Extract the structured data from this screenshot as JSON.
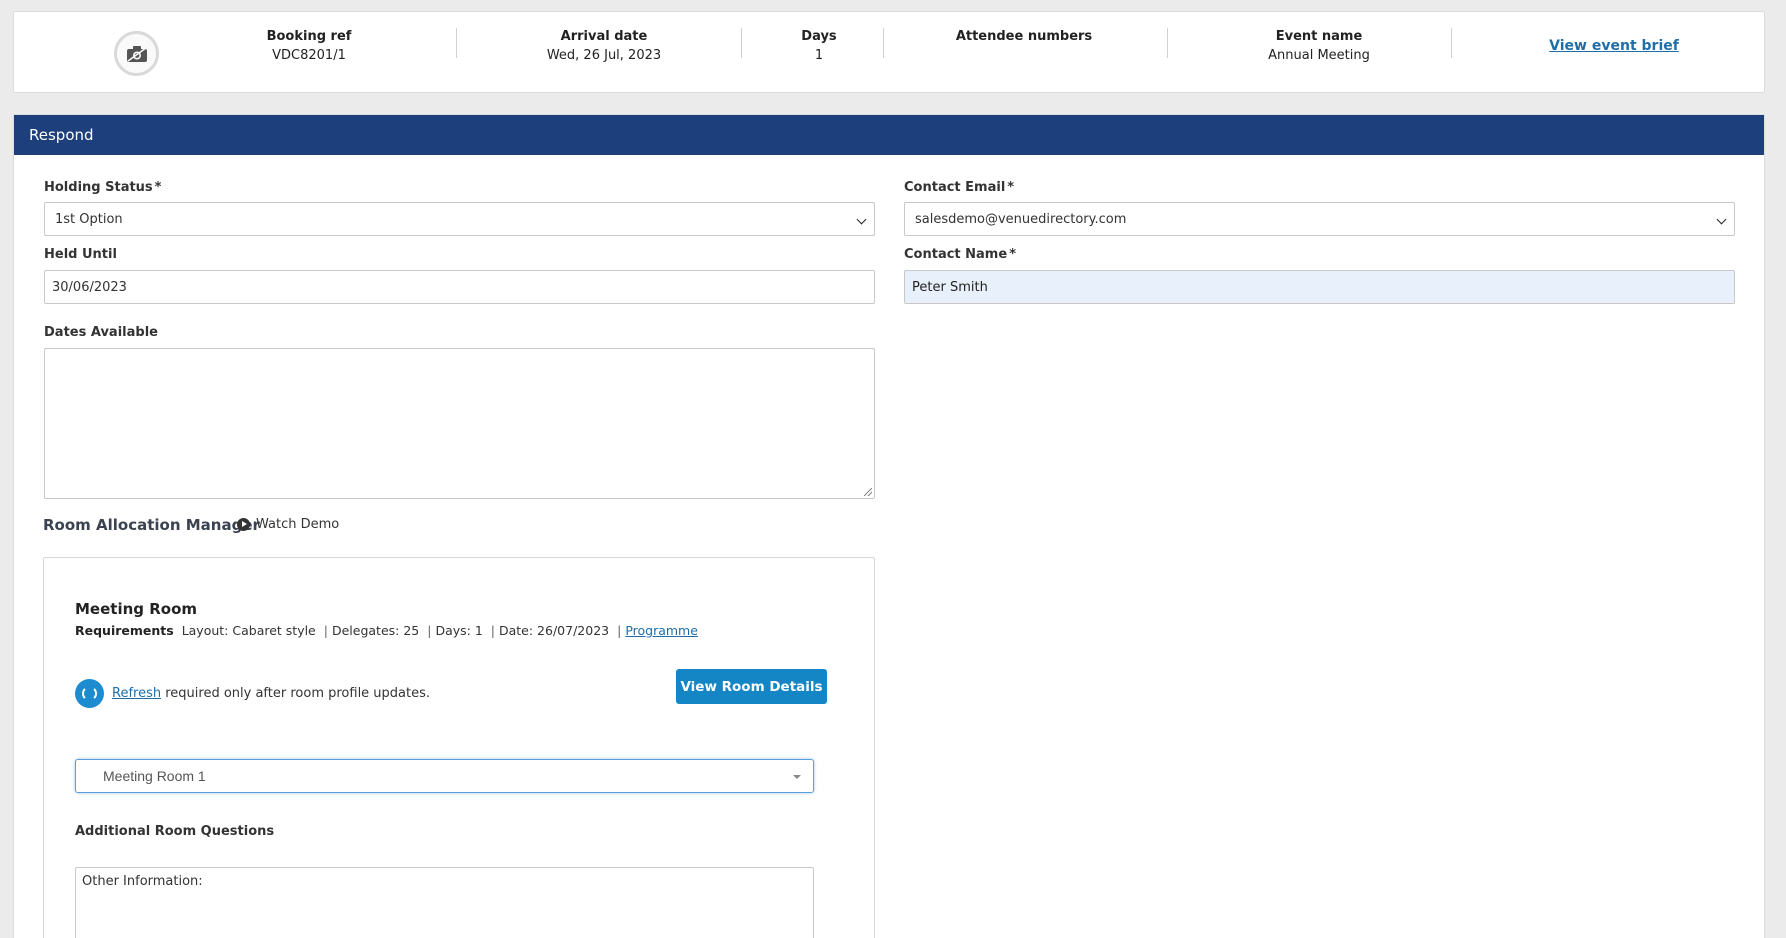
{
  "summary": {
    "booking_ref_label": "Booking ref",
    "booking_ref": "VDC8201/1",
    "arrival_label": "Arrival date",
    "arrival": "Wed, 26 Jul, 2023",
    "days_label": "Days",
    "days": "1",
    "attendees_label": "Attendee numbers",
    "attendees": "",
    "event_label": "Event name",
    "event": "Annual Meeting",
    "view_brief": "View event brief"
  },
  "panel": {
    "title": "Respond"
  },
  "form": {
    "holding_status_label": "Holding Status",
    "holding_status_value": "1st Option",
    "held_until_label": "Held Until",
    "held_until_value": "30/06/2023",
    "dates_available_label": "Dates Available",
    "dates_available_value": "",
    "contact_email_label": "Contact Email",
    "contact_email_value": "salesdemo@venuedirectory.com",
    "contact_name_label": "Contact Name",
    "contact_name_value": "Peter Smith",
    "required_mark": "*"
  },
  "room_allocation": {
    "title": "Room Allocation Manager",
    "watch_demo": "Watch Demo",
    "room_name": "Meeting Room",
    "requirements_label": "Requirements",
    "layout": "Layout: Cabaret style",
    "delegates": "Delegates: 25",
    "days": "Days: 1",
    "date": "Date: 26/07/2023",
    "programme_link": "Programme",
    "refresh_link": "Refresh",
    "refresh_text": "required only after room profile updates.",
    "view_room_details": "View Room Details",
    "selected_room": "Meeting Room 1",
    "additional_questions": "Additional Room Questions",
    "other_info": "Other Information:"
  },
  "colors": {
    "header_bar": "#1d3f7b",
    "primary_button": "#1486c6",
    "link": "#1f6ea9",
    "filled_input": "#e8f0fb"
  },
  "icons": [
    "camera-icon",
    "play-circle-icon",
    "refresh-icon",
    "chevron-down-icon",
    "caret-down-icon",
    "resize-grip-icon"
  ]
}
